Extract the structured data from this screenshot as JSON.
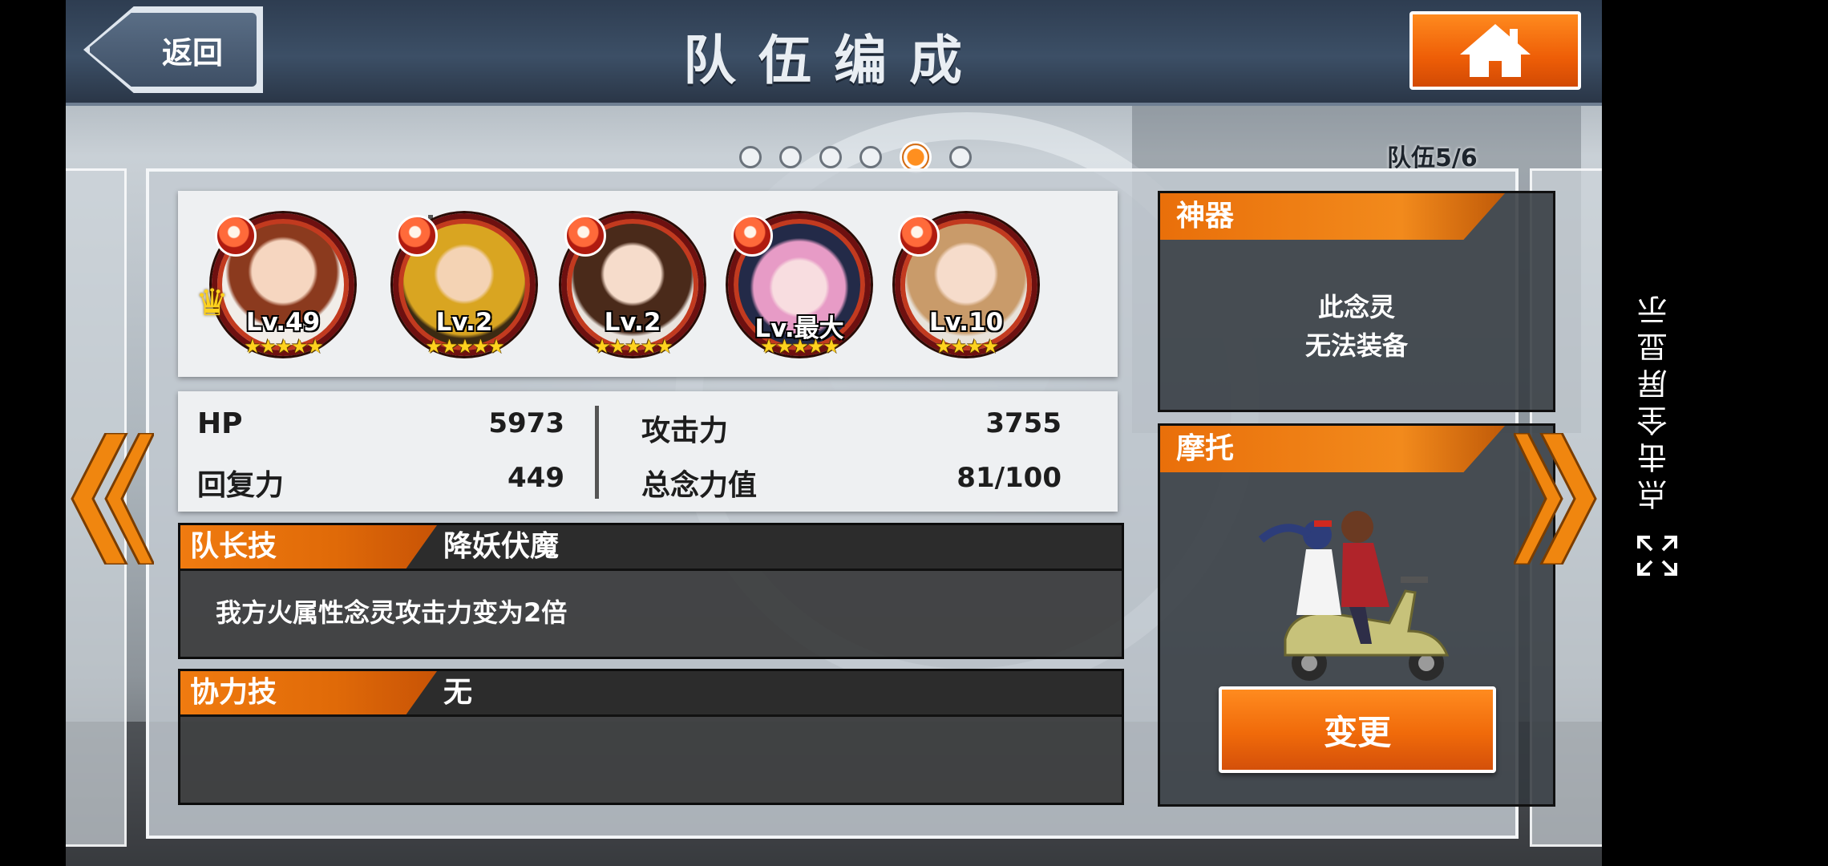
{
  "header": {
    "back_label": "返回",
    "title": "队伍编成"
  },
  "pager": {
    "total": 6,
    "active_index": 4,
    "team_label": "队伍5/6"
  },
  "members": [
    {
      "level": "Lv.49",
      "stars": "★★★★★",
      "leader": true
    },
    {
      "level": "Lv.2",
      "stars": "★★★★★",
      "leader": false
    },
    {
      "level": "Lv.2",
      "stars": "★★★★★",
      "leader": false
    },
    {
      "level": "Lv.最大",
      "stars": "★★★★★",
      "leader": false
    },
    {
      "level": "Lv.10",
      "stars": "★★★★",
      "leader": false
    }
  ],
  "stats": {
    "hp_label": "HP",
    "hp_value": "5973",
    "atk_label": "攻击力",
    "atk_value": "3755",
    "rec_label": "回复力",
    "rec_value": "449",
    "cost_label": "总念力值",
    "cost_value": "81/100"
  },
  "leader_skill": {
    "tag": "队长技",
    "name": "降妖伏魔",
    "desc": "我方火属性念灵攻击力变为2倍"
  },
  "coop_skill": {
    "tag": "协力技",
    "name": "无"
  },
  "relic": {
    "tag": "神器",
    "line1": "此念灵",
    "line2": "无法装备"
  },
  "vehicle": {
    "tag": "摩托",
    "change_label": "变更"
  },
  "fullscreen": {
    "hint": "点击全屏显示"
  },
  "colors": {
    "accent_orange": "#f07b10",
    "header_blue": "#3c4f66",
    "fire_red": "#c23a1f"
  }
}
